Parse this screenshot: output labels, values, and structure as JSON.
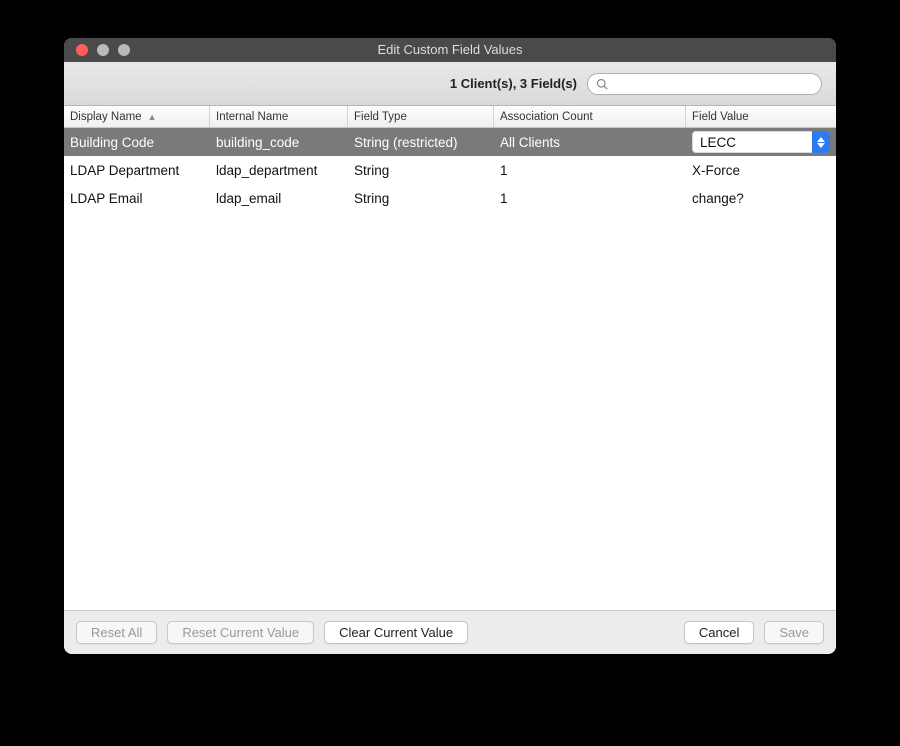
{
  "window": {
    "title": "Edit Custom Field Values"
  },
  "toolbar": {
    "summary": "1 Client(s), 3 Field(s)",
    "search_placeholder": ""
  },
  "columns": {
    "c0": "Display Name",
    "c1": "Internal Name",
    "c2": "Field Type",
    "c3": "Association Count",
    "c4": "Field Value",
    "sort_col": 0,
    "sort_dir": "asc"
  },
  "rows": [
    {
      "selected": true,
      "display_name": "Building Code",
      "internal_name": "building_code",
      "field_type": "String (restricted)",
      "assoc_count": "All Clients",
      "field_value": "LECC",
      "field_value_editor": "select"
    },
    {
      "selected": false,
      "display_name": "LDAP Department",
      "internal_name": "ldap_department",
      "field_type": "String",
      "assoc_count": "1",
      "field_value": "X-Force",
      "field_value_editor": "text"
    },
    {
      "selected": false,
      "display_name": "LDAP Email",
      "internal_name": "ldap_email",
      "field_type": "String",
      "assoc_count": "1",
      "field_value": "change?",
      "field_value_editor": "text"
    }
  ],
  "buttons": {
    "reset_all": "Reset All",
    "reset_current": "Reset Current Value",
    "clear_current": "Clear Current Value",
    "cancel": "Cancel",
    "save": "Save"
  }
}
